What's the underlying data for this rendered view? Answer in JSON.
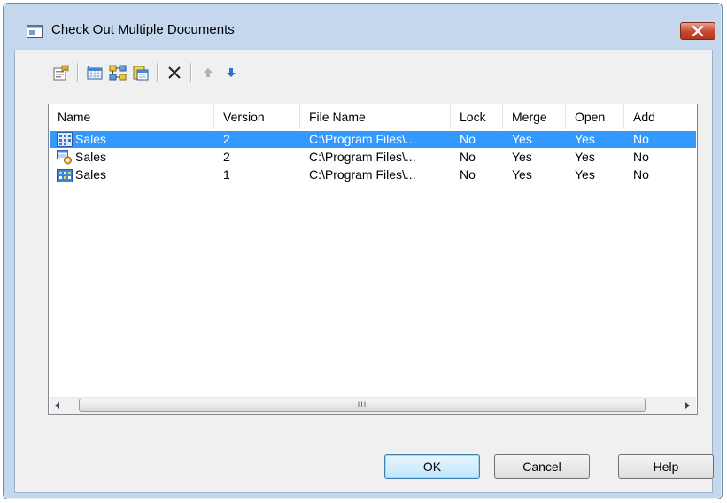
{
  "window": {
    "title": "Check Out Multiple Documents",
    "accent": "#3399ff"
  },
  "toolbar": {
    "buttons": [
      {
        "icon": "properties-icon"
      },
      {
        "icon": "select-all-icon"
      },
      {
        "icon": "select-models-icon"
      },
      {
        "icon": "select-files-icon"
      },
      {
        "icon": "delete-icon"
      },
      {
        "icon": "move-up-icon"
      },
      {
        "icon": "move-down-icon"
      }
    ]
  },
  "list": {
    "columns": [
      "Name",
      "Version",
      "File Name",
      "Lock",
      "Merge",
      "Open",
      "Add"
    ],
    "rows": [
      {
        "icon": "model-grid-icon",
        "name": "Sales",
        "version": "2",
        "file": "C:\\Program Files\\...",
        "lock": "No",
        "merge": "Yes",
        "open": "Yes",
        "add": "No",
        "selected": true
      },
      {
        "icon": "model-gear-icon",
        "name": "Sales",
        "version": "2",
        "file": "C:\\Program Files\\...",
        "lock": "No",
        "merge": "Yes",
        "open": "Yes",
        "add": "No",
        "selected": false
      },
      {
        "icon": "model-building-icon",
        "name": "Sales",
        "version": "1",
        "file": "C:\\Program Files\\...",
        "lock": "No",
        "merge": "Yes",
        "open": "Yes",
        "add": "No",
        "selected": false
      }
    ],
    "scrollbar_grip": "III"
  },
  "buttons": {
    "ok": "OK",
    "cancel": "Cancel",
    "help": "Help"
  }
}
